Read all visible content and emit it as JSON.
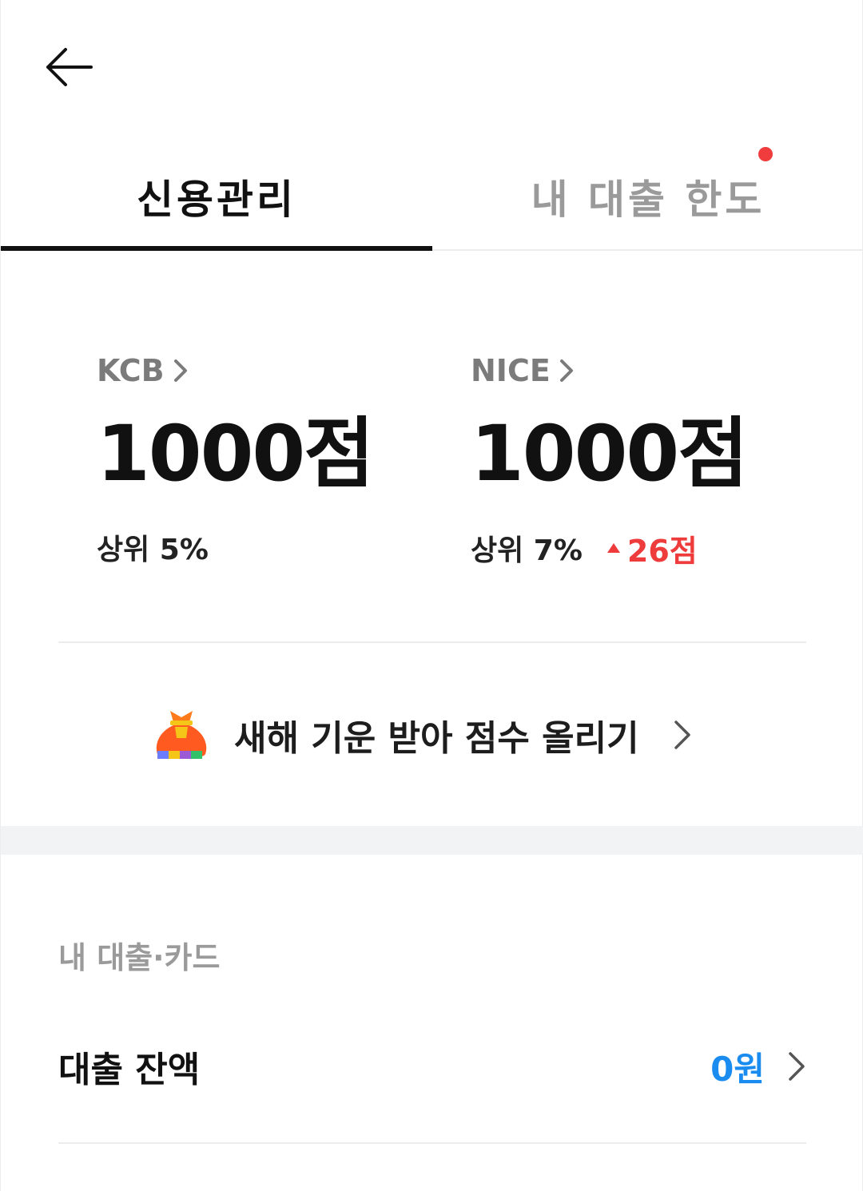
{
  "tabs": [
    {
      "label": "신용관리"
    },
    {
      "label": "내 대출 한도"
    }
  ],
  "scores": {
    "kcb": {
      "bureau": "KCB",
      "score": "1000점",
      "rank": "상위 5%"
    },
    "nice": {
      "bureau": "NICE",
      "score": "1000점",
      "rank": "상위 7%",
      "change": "26점"
    }
  },
  "promo": {
    "text": "새해 기운 받아 점수 올리기"
  },
  "section": {
    "label": "내 대출·카드"
  },
  "loan": {
    "label": "대출 잔액",
    "amount": "0원"
  },
  "colors": {
    "accent_blue": "#1a8cf0",
    "alert_red": "#ee3b3b",
    "dot_red": "#f03c3c"
  }
}
